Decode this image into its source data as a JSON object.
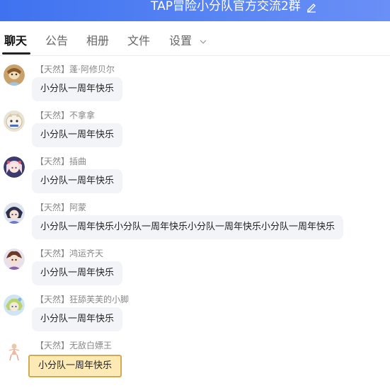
{
  "window": {
    "title": "TAP冒险小分队官方交流2群"
  },
  "tabs": [
    {
      "label": "聊天"
    },
    {
      "label": "公告"
    },
    {
      "label": "相册"
    },
    {
      "label": "文件"
    },
    {
      "label": "设置"
    }
  ],
  "messages": [
    {
      "sender": "【天然】蓬·阿修贝尔",
      "text": "小分队一周年快乐"
    },
    {
      "sender": "【天然】不拿拿",
      "text": "小分队一周年快乐"
    },
    {
      "sender": "【天然】插曲",
      "text": "小分队一周年快乐"
    },
    {
      "sender": "【天然】阿蒙",
      "text": "小分队一周年快乐小分队一周年快乐小分队一周年快乐小分队一周年快乐"
    },
    {
      "sender": "【天然】鸿运齐天",
      "text": "小分队一周年快乐"
    },
    {
      "sender": "【天然】狂舔芙芙的小脚",
      "text": "小分队一周年快乐"
    },
    {
      "sender": "【天然】无敌白嫖王",
      "text": "小分队一周年快乐"
    }
  ],
  "colors": {
    "titlebar": "#4a7cf2",
    "bubble": "#f3f4f8",
    "special_bubble": "#fde9b4",
    "special_border": "#d9a64a"
  },
  "icons": {
    "edit": "pencil-icon",
    "settings_dropdown": "chevron-down-icon"
  }
}
